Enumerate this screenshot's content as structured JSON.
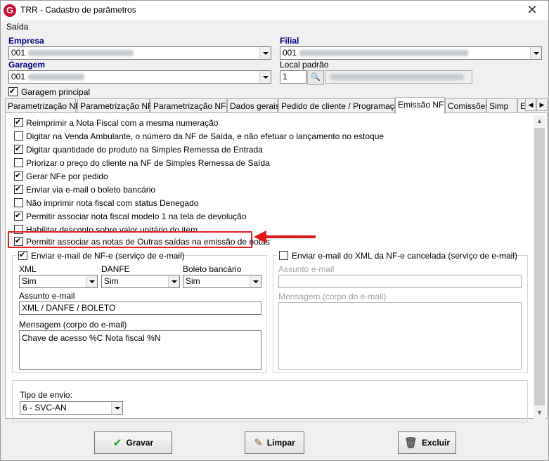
{
  "window": {
    "title": "TRR - Cadastro de parâmetros",
    "subtitle": "Saída"
  },
  "header": {
    "empresa_label": "Empresa",
    "empresa_code": "001",
    "filial_label": "Filial",
    "filial_code": "001",
    "garagem_label": "Garagem",
    "garagem_code": "001",
    "local_padrao_label": "Local padrão",
    "local_padrao_value": "1",
    "garagem_principal_label": "Garagem principal",
    "garagem_principal_checked": true
  },
  "tabs": [
    {
      "label": "Parametrização NF",
      "active": false
    },
    {
      "label": "Parametrização NF",
      "active": false
    },
    {
      "label": "Parametrização NF-e",
      "active": false
    },
    {
      "label": "Dados gerais",
      "active": false
    },
    {
      "label": "Pedido de cliente / Programação",
      "active": false
    },
    {
      "label": "Emissão NF",
      "active": true
    },
    {
      "label": "Comissões",
      "active": false
    },
    {
      "label": "Simp",
      "active": false
    },
    {
      "label": "E",
      "active": false
    }
  ],
  "options": [
    {
      "label": "Reimprimir a Nota Fiscal com a mesma numeração",
      "checked": true
    },
    {
      "label": "Digitar na Venda Ambulante, o número da NF de Saída, e não efetuar o lançamento no estoque",
      "checked": false
    },
    {
      "label": "Digitar quantidade do produto na Simples Remessa de Entrada",
      "checked": true
    },
    {
      "label": "Priorizar o preço do cliente na NF de Simples Remessa de Saída",
      "checked": false
    },
    {
      "label": "Gerar NFe por pedido",
      "checked": true
    },
    {
      "label": "Enviar via e-mail o boleto bancário",
      "checked": true
    },
    {
      "label": "Não imprimir nota fiscal com status Denegado",
      "checked": false
    },
    {
      "label": "Permitir associar nota fiscal modelo 1 na tela de devolução",
      "checked": true
    },
    {
      "label": "Habilitar desconto sobre valor unitário do item",
      "checked": false
    },
    {
      "label": "Permitir associar as notas de Outras saídas na emissão de notas",
      "checked": true
    }
  ],
  "email_nfe": {
    "title": "Enviar e-mail de NF-e (serviço de e-mail)",
    "checked": true,
    "xml_label": "XML",
    "xml_value": "Sim",
    "danfe_label": "DANFE",
    "danfe_value": "Sim",
    "boleto_label": "Boleto bancário",
    "boleto_value": "Sim",
    "assunto_label": "Assunto e-mail",
    "assunto_value": "XML / DANFE / BOLETO",
    "mensagem_label": "Mensagem (corpo do e-mail)",
    "mensagem_value": "Chave de acesso %C Nota fiscal %N"
  },
  "email_xml_cancelada": {
    "title": "Enviar e-mail do XML da NF-e cancelada (serviço de e-mail)",
    "checked": false,
    "assunto_label": "Assunto e-mail",
    "mensagem_label": "Mensagem (corpo do e-mail)"
  },
  "envio": {
    "label": "Tipo de envio:",
    "value": "6 - SVC-AN"
  },
  "buttons": {
    "gravar": "Gravar",
    "limpar": "Limpar",
    "excluir": "Excluir"
  },
  "colors": {
    "highlight": "#e02020",
    "label_blue": "#00007f"
  }
}
